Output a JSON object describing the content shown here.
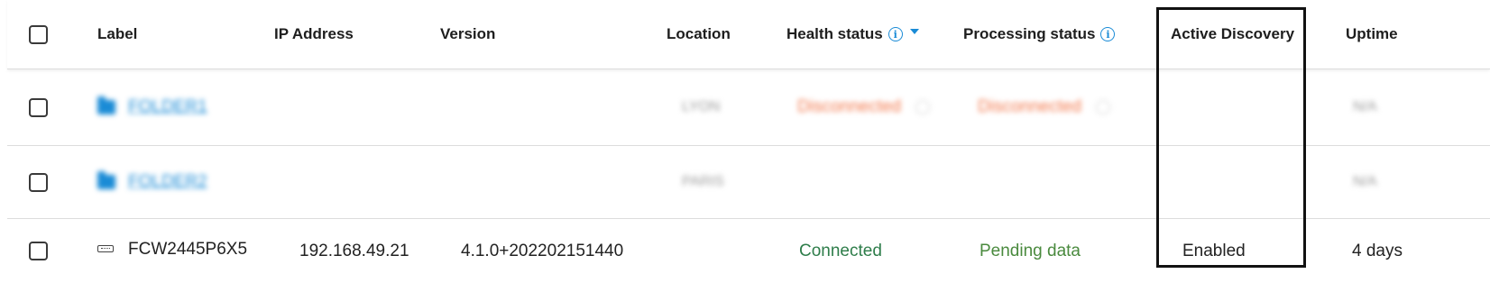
{
  "header": {
    "label": "Label",
    "ip": "IP Address",
    "version": "Version",
    "location": "Location",
    "health": "Health status",
    "processing": "Processing status",
    "active_discovery": "Active Discovery",
    "uptime": "Uptime"
  },
  "rows": [
    {
      "label": "FOLDER1",
      "location": "LYON",
      "health": "Disconnected",
      "processing": "Disconnected",
      "uptime": "N/A"
    },
    {
      "label": "FOLDER2",
      "location": "PARIS",
      "uptime": "N/A"
    },
    {
      "label": "FCW2445P6X5",
      "ip": "192.168.49.21",
      "version": "4.1.0+202202151440",
      "health": "Connected",
      "processing": "Pending data",
      "active_discovery": "Enabled",
      "uptime": "4 days"
    }
  ],
  "colors": {
    "accent": "#1a8bd6",
    "connected": "#2e7d4a",
    "disconnected": "#f2774b",
    "highlight_border": "#111111"
  },
  "icons": {
    "header_info": "info-icon",
    "sort": "sort-desc-icon",
    "folder": "folder-icon",
    "device": "device-icon"
  }
}
